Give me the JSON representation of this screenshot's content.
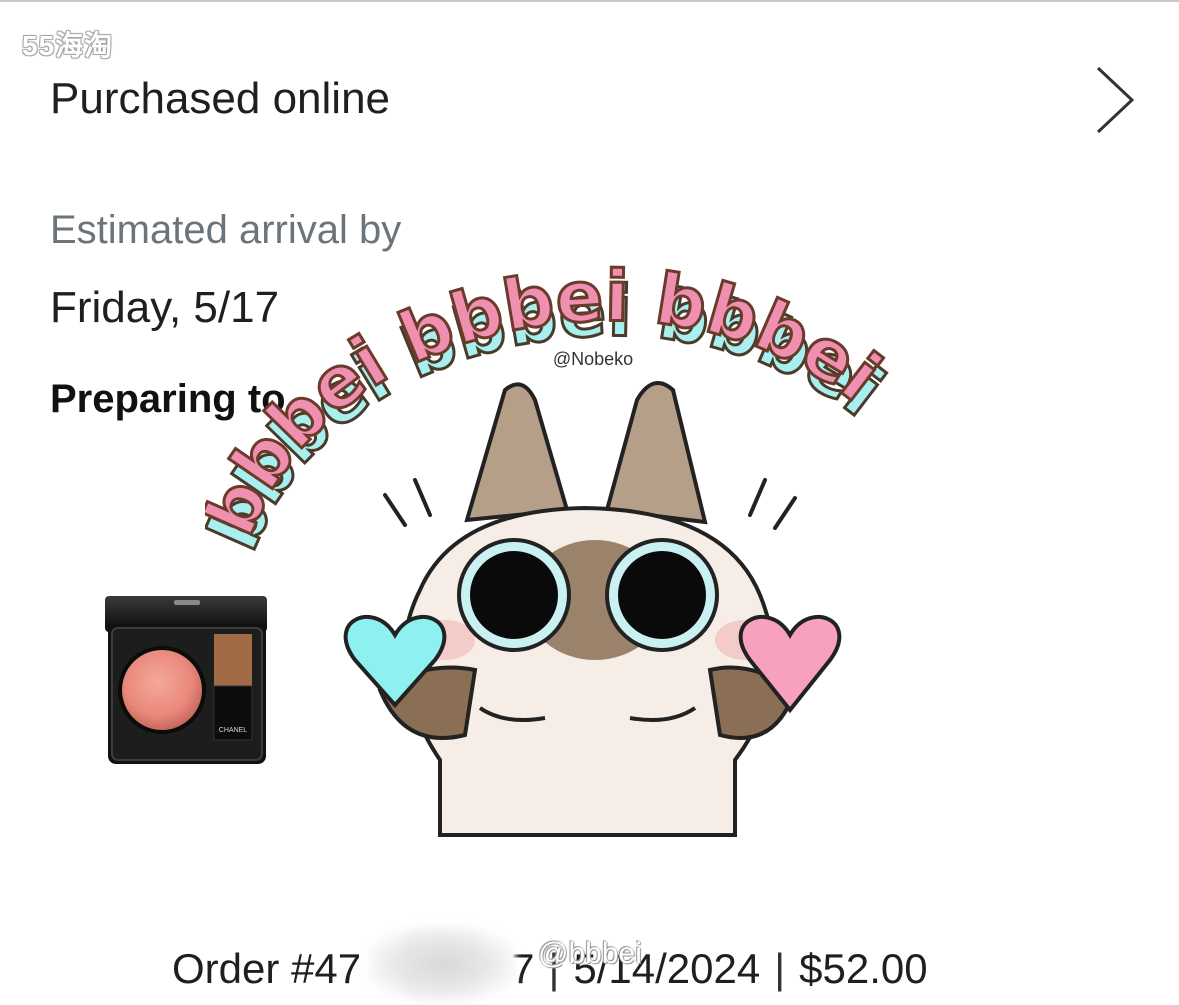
{
  "watermark_top": "55海淘",
  "order_card": {
    "title": "Purchased online",
    "eta_label": "Estimated arrival by",
    "eta_date": "Friday, 5/17",
    "status": "Preparing to",
    "order_number": "Order #47",
    "order_suffix": "7",
    "order_date": "5/14/2024",
    "order_total": "$52.00",
    "separator": "|"
  },
  "product_image": {
    "brand_text": "CHANEL",
    "icon": "blush-compact"
  },
  "sticker": {
    "arc_text": "bbbei bbbei bbbei",
    "credit": "@Nobeko",
    "icon": "siamese-cat-with-hearts"
  },
  "weibo_watermark": "@bbbei",
  "colors": {
    "title_text": "#1f1f1f",
    "muted_text": "#6b747b",
    "sticker_pink": "#f090b0",
    "sticker_cyan": "#a8f0f0"
  }
}
